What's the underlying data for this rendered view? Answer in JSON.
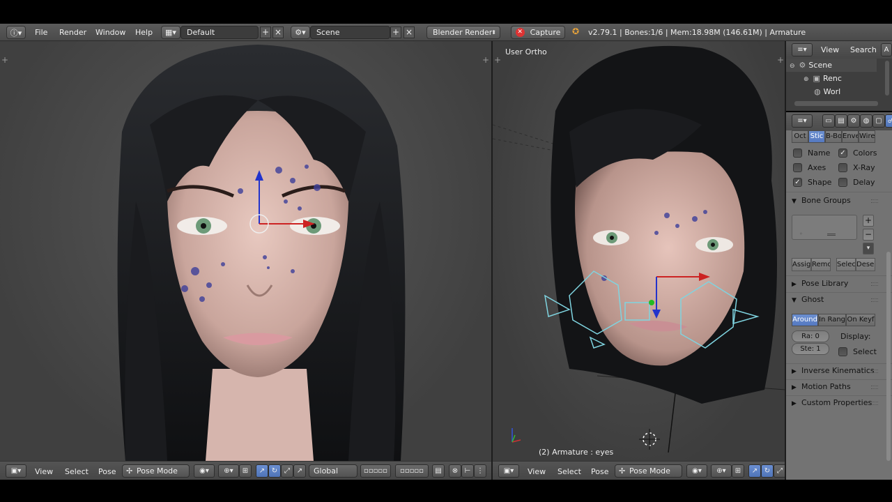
{
  "main_header": {
    "menus": [
      "File",
      "Render",
      "Window",
      "Help"
    ],
    "layout": "Default",
    "scene": "Scene",
    "engine": "Blender Render",
    "capture": "Capture",
    "info": "v2.79.1 | Bones:1/6 | Mem:18.98M (146.61M) | Armature"
  },
  "left_viewport": {
    "header": {
      "menus": [
        "View",
        "Select",
        "Pose"
      ],
      "mode": "Pose Mode",
      "orientation": "Global"
    }
  },
  "right_viewport": {
    "view_label": "User Ortho",
    "status": "(2) Armature : eyes",
    "header": {
      "menus": [
        "View",
        "Select",
        "Pose"
      ],
      "mode": "Pose Mode"
    }
  },
  "outliner": {
    "menus": [
      "View",
      "Search"
    ],
    "items": [
      "Scene",
      "Renc",
      "Worl"
    ]
  },
  "properties": {
    "display_tabs": [
      "Oct",
      "Stic",
      "B-Bo",
      "Enve",
      "Wire"
    ],
    "checks": [
      {
        "label": "Name",
        "checked": false
      },
      {
        "label": "Colors",
        "checked": true
      },
      {
        "label": "Axes",
        "checked": false
      },
      {
        "label": "X-Ray",
        "checked": false
      },
      {
        "label": "Shape",
        "checked": true
      },
      {
        "label": "Delay",
        "checked": false
      }
    ],
    "bone_groups": "Bone Groups",
    "bone_group_buttons": [
      "Assig",
      "Remo",
      "Selec",
      "Desel"
    ],
    "pose_library": "Pose Library",
    "ghost": "Ghost",
    "ghost_tabs": [
      "Around",
      "In Rang",
      "On Keyf"
    ],
    "range_field": "Ra:  0",
    "step_field": "Ste:  1",
    "display_label": "Display:",
    "select_label": "Select",
    "panels": [
      "Inverse Kinematics",
      "Motion Paths",
      "Custom Properties"
    ]
  },
  "colors": {
    "accent": "#5a7ec4",
    "header": "#4f4f4f",
    "panel": "#737373"
  }
}
